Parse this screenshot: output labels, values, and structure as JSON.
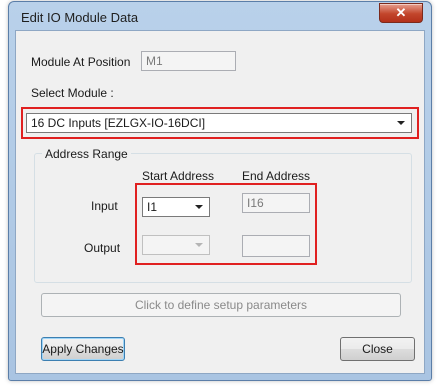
{
  "window": {
    "title": "Edit IO Module Data",
    "close_glyph": "✕"
  },
  "module_position": {
    "label": "Module At Position",
    "value": "M1"
  },
  "select_module": {
    "label": "Select Module :",
    "value": "16 DC Inputs [EZLGX-IO-16DCI]"
  },
  "address_range": {
    "title": "Address Range",
    "start_header": "Start Address",
    "end_header": "End Address",
    "input": {
      "label": "Input",
      "start": "I1",
      "end": "I16"
    },
    "output": {
      "label": "Output",
      "start": "",
      "end": ""
    }
  },
  "setup_button": "Click to define setup parameters",
  "apply_button": "Apply Changes",
  "close_button": "Close",
  "colors": {
    "highlight": "#e02020",
    "title_bar": "#b9d1ea",
    "close_button": "#c2452b"
  }
}
